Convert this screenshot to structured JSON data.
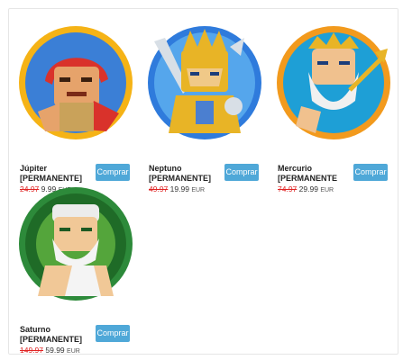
{
  "products": [
    {
      "name_line1": "Júpiter",
      "name_line2": "[PERMANENTE]",
      "old_price": "24.97",
      "new_price": "9.99",
      "currency": "EUR",
      "button": "Comprar",
      "icon": "jupiter-character-icon",
      "colors": {
        "ring": "#f5b316",
        "bg": "#3b7fd6",
        "accent": "#d9322b"
      }
    },
    {
      "name_line1": "Neptuno",
      "name_line2": "[PERMANENTE]",
      "old_price": "49.97",
      "new_price": "19.99",
      "currency": "EUR",
      "button": "Comprar",
      "icon": "neptuno-character-icon",
      "colors": {
        "ring": "#2f7bdc",
        "bg": "#55a6ec",
        "accent": "#e8b426"
      }
    },
    {
      "name_line1": "Mercurio",
      "name_line2": "[PERMANENTE",
      "old_price": "74.97",
      "new_price": "29.99",
      "currency": "EUR",
      "button": "Comprar",
      "icon": "mercurio-character-icon",
      "colors": {
        "ring": "#f29a1d",
        "bg": "#1e9fd6",
        "accent": "#f0f0f0"
      }
    },
    {
      "name_line1": "Saturno",
      "name_line2": "[PERMANENTE]",
      "old_price": "149.97",
      "new_price": "59.99",
      "currency": "EUR",
      "button": "Comprar",
      "icon": "saturno-character-icon",
      "colors": {
        "ring": "#2d8a3a",
        "bg": "#1f6b27",
        "accent": "#7fd64d"
      }
    }
  ]
}
